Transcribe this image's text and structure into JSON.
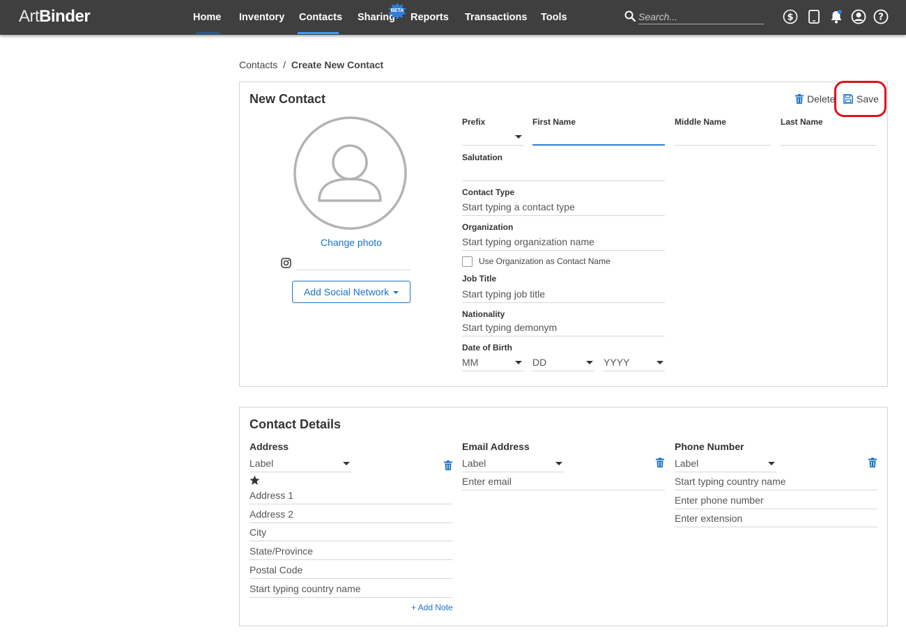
{
  "app": {
    "logo_part1": "Art",
    "logo_part2": "Binder"
  },
  "nav": {
    "items": [
      "Home",
      "Inventory",
      "Contacts",
      "Sharing",
      "Reports",
      "Transactions",
      "Tools"
    ],
    "active": "Contacts",
    "beta_badge": "BETA",
    "search_placeholder": "Search..."
  },
  "icons": {
    "top_right": [
      "dollar-circle-icon",
      "tablet-icon",
      "bell-icon",
      "user-circle-icon",
      "help-circle-icon"
    ],
    "accent": "#1a73c9",
    "nav_bg": "#3f3f3f"
  },
  "breadcrumb": {
    "parent": "Contacts",
    "separator": "/",
    "current": "Create New Contact"
  },
  "new_contact": {
    "title": "New Contact",
    "delete_label": "Delete",
    "save_label": "Save",
    "change_photo": "Change photo",
    "add_social_network": "Add Social Network",
    "labels": {
      "prefix": "Prefix",
      "first_name": "First Name",
      "middle_name": "Middle Name",
      "last_name": "Last Name",
      "salutation": "Salutation",
      "contact_type": "Contact Type",
      "organization": "Organization",
      "job_title": "Job Title",
      "nationality": "Nationality",
      "date_of_birth": "Date of Birth"
    },
    "placeholders": {
      "contact_type": "Start typing a contact type",
      "organization": "Start typing organization name",
      "job_title": "Start typing job title",
      "nationality": "Start typing demonym"
    },
    "use_org_checkbox": "Use Organization as Contact Name",
    "dob": {
      "month": "MM",
      "day": "DD",
      "year": "YYYY"
    }
  },
  "contact_details": {
    "title": "Contact Details",
    "address": {
      "label": "Address",
      "select": "Label",
      "fields": [
        "Address 1",
        "Address 2",
        "City",
        "State/Province",
        "Postal Code",
        "Start typing country name"
      ],
      "add_note": "+ Add Note"
    },
    "email": {
      "label": "Email Address",
      "select": "Label",
      "placeholder": "Enter email"
    },
    "phone": {
      "label": "Phone Number",
      "select": "Label",
      "fields": [
        "Start typing country name",
        "Enter phone number",
        "Enter extension"
      ]
    }
  }
}
